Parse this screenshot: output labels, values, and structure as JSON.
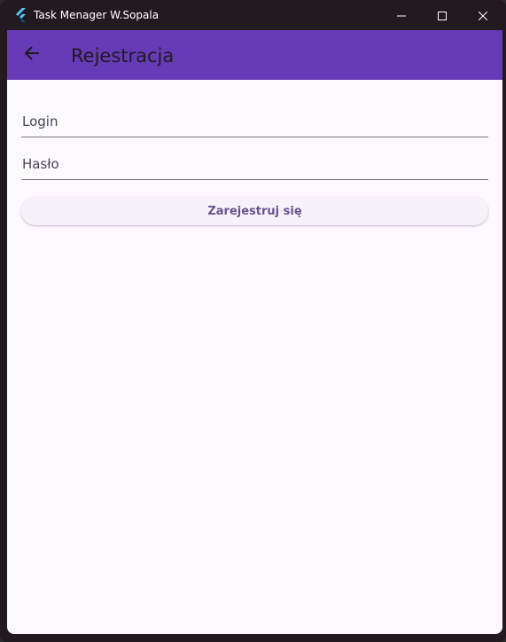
{
  "window": {
    "title": "Task Menager W.Sopala",
    "app_icon": "flutter-icon",
    "controls": {
      "minimize_icon": "minimize-icon",
      "maximize_icon": "maximize-icon",
      "close_icon": "close-icon"
    }
  },
  "appbar": {
    "back_icon": "arrow-back-icon",
    "title": "Rejestracja"
  },
  "form": {
    "login": {
      "placeholder": "Login",
      "value": ""
    },
    "password": {
      "placeholder": "Hasło",
      "value": ""
    },
    "submit_label": "Zarejestruj się"
  },
  "colors": {
    "appbar": "#673ab7",
    "background": "#fdf7fe",
    "button_text": "#65558f",
    "titlebar": "#221a1f"
  }
}
